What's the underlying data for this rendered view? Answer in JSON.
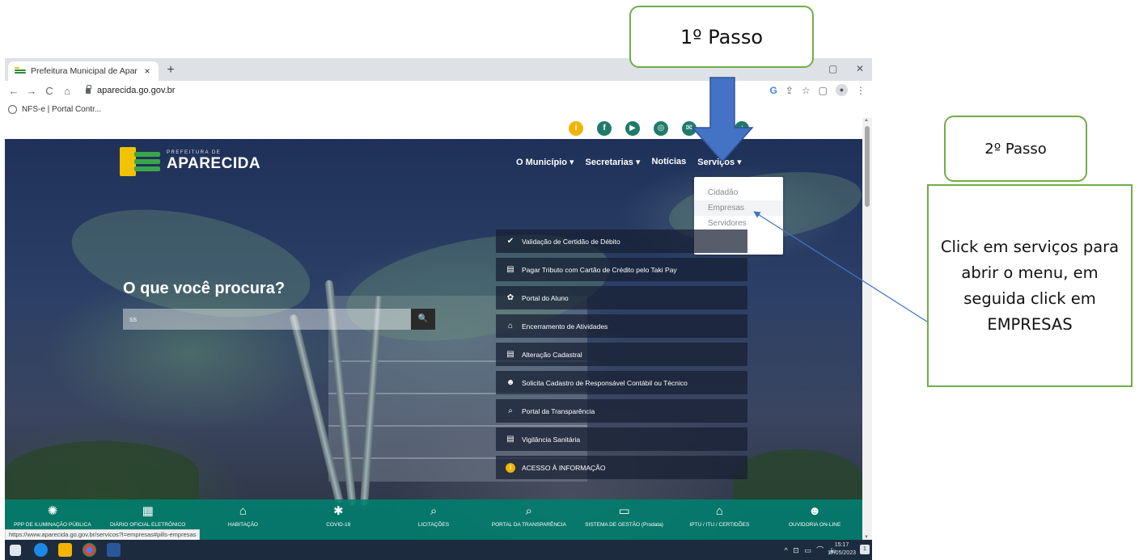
{
  "browser": {
    "tab_title": "Prefeitura Municipal de Aparecid",
    "tab_close": "×",
    "new_tab": "+",
    "window_controls": [
      "▢",
      "✕"
    ],
    "nav_back": "←",
    "nav_forward": "→",
    "nav_reload": "C",
    "nav_home": "⌂",
    "url": "aparecida.go.gov.br",
    "toolbar_icons": [
      "G",
      "⇪",
      "☆",
      "▢",
      "●",
      "⋮"
    ],
    "bookmark": "NFS-e | Portal Contr..."
  },
  "site": {
    "social_icons": [
      "i",
      "f",
      "▶",
      "◎",
      "✉",
      "♪"
    ],
    "logo_small": "PREFEITURA DE",
    "logo_big": "APARECIDA",
    "nav": [
      "O Município ▾",
      "Secretarias ▾",
      "Notícias",
      "Serviços ▾"
    ],
    "dropdown": [
      "Cidadão",
      "Empresas",
      "Servidores"
    ],
    "search_title": "O que você procura?",
    "search_value": "ss",
    "search_button": "🔍",
    "services": [
      {
        "icon": "✔",
        "label": "Validação de Certidão de Débito"
      },
      {
        "icon": "▤",
        "label": "Pagar Tributo com Cartão de Crédito pelo Taki Pay"
      },
      {
        "icon": "✿",
        "label": "Portal do Aluno"
      },
      {
        "icon": "⌂",
        "label": "Encerramento de Atividades"
      },
      {
        "icon": "▤",
        "label": "Alteração Cadastral"
      },
      {
        "icon": "☻",
        "label": "Solicita Cadastro de Responsável Contábil ou Técnico"
      },
      {
        "icon": "⌕",
        "label": "Portal da Transparência"
      },
      {
        "icon": "▤",
        "label": "Vigilância Sanitária"
      },
      {
        "icon": "i",
        "label": "ACESSO À INFORMAÇÃO"
      }
    ],
    "bottom_bar": [
      {
        "icon": "✺",
        "label": "PPP DE ILUMINAÇÃO PÚBLICA"
      },
      {
        "icon": "▦",
        "label": "DIÁRIO OFICIAL ELETRÔNICO"
      },
      {
        "icon": "⌂",
        "label": "HABITAÇÃO"
      },
      {
        "icon": "✱",
        "label": "COVID-19"
      },
      {
        "icon": "⌕",
        "label": "LICITAÇÕES"
      },
      {
        "icon": "⌕",
        "label": "PORTAL DA TRANSPARÊNCIA"
      },
      {
        "icon": "▭",
        "label": "SISTEMA DE GESTÃO (Prodata)"
      },
      {
        "icon": "⌂",
        "label": "IPTU / ITU / CERTIDÕES"
      },
      {
        "icon": "☻",
        "label": "OUVIDORIA ON-LINE"
      }
    ],
    "status_url": "https://www.aparecida.go.gov.br/servicos?l=empresas#pills-empresas"
  },
  "taskbar": {
    "tray": "^ ⊡ ▭ ⌒ 🔈",
    "time": "15:17",
    "date": "17/05/2023",
    "notifications": "1"
  },
  "annotations": {
    "step1": "1º Passo",
    "step2": "2º Passo",
    "instruction": "Click em serviços para abrir o menu, em seguida click em EMPRESAS",
    "arrow_color": "#4472c4",
    "border_color": "#70ad47"
  }
}
